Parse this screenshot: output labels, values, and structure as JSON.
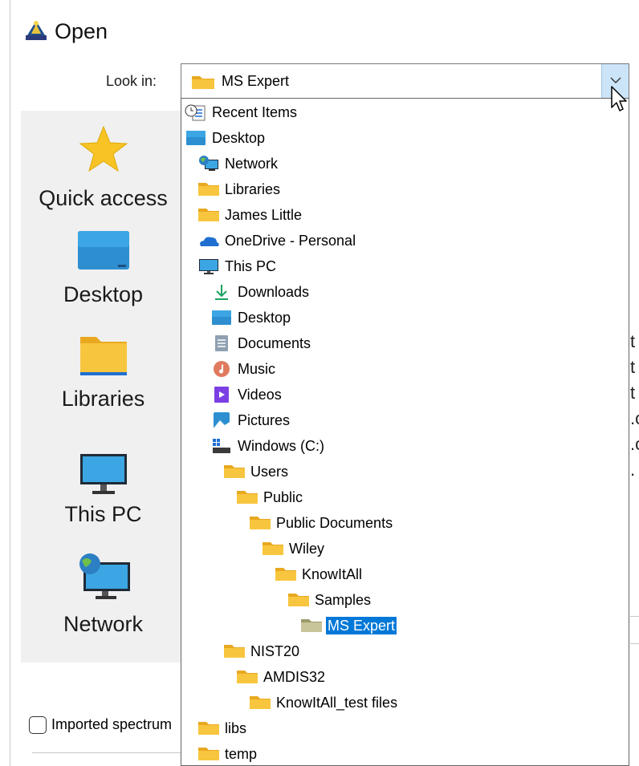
{
  "window": {
    "title": "Open"
  },
  "look_in": {
    "label": "Look in:",
    "value": "MS Expert"
  },
  "places": [
    {
      "label": "Quick access",
      "icon": "star-icon"
    },
    {
      "label": "Desktop",
      "icon": "desktop-icon"
    },
    {
      "label": "Libraries",
      "icon": "folder-icon"
    },
    {
      "label": "This PC",
      "icon": "monitor-icon"
    },
    {
      "label": "Network",
      "icon": "network-icon"
    }
  ],
  "dropdown": {
    "items": [
      {
        "label": "Recent Items",
        "icon": "recent-items-icon",
        "level": 0
      },
      {
        "label": "Desktop",
        "icon": "desktop-icon",
        "level": 0
      },
      {
        "label": "Network",
        "icon": "network-icon",
        "level": 1
      },
      {
        "label": "Libraries",
        "icon": "folder-icon",
        "level": 1
      },
      {
        "label": "James Little",
        "icon": "folder-icon",
        "level": 1
      },
      {
        "label": "OneDrive - Personal",
        "icon": "onedrive-icon",
        "level": 1
      },
      {
        "label": "This PC",
        "icon": "monitor-icon",
        "level": 1
      },
      {
        "label": "Downloads",
        "icon": "downloads-icon",
        "level": 2
      },
      {
        "label": "Desktop",
        "icon": "desktop-icon",
        "level": 2
      },
      {
        "label": "Documents",
        "icon": "documents-icon",
        "level": 2
      },
      {
        "label": "Music",
        "icon": "music-icon",
        "level": 2
      },
      {
        "label": "Videos",
        "icon": "videos-icon",
        "level": 2
      },
      {
        "label": "Pictures",
        "icon": "pictures-icon",
        "level": 2
      },
      {
        "label": "Windows (C:)",
        "icon": "drive-icon",
        "level": 2
      },
      {
        "label": "Users",
        "icon": "folder-icon",
        "level": 3
      },
      {
        "label": "Public",
        "icon": "folder-icon",
        "level": 4
      },
      {
        "label": "Public Documents",
        "icon": "folder-icon",
        "level": 5
      },
      {
        "label": "Wiley",
        "icon": "folder-icon",
        "level": 6
      },
      {
        "label": "KnowItAll",
        "icon": "folder-icon",
        "level": 7
      },
      {
        "label": "Samples",
        "icon": "folder-icon",
        "level": 8
      },
      {
        "label": "MS Expert",
        "icon": "folder-open-icon",
        "level": 9,
        "selected": true
      },
      {
        "label": "NIST20",
        "icon": "folder-icon",
        "level": 3
      },
      {
        "label": "AMDIS32",
        "icon": "folder-icon",
        "level": 4
      },
      {
        "label": "KnowItAll_test files",
        "icon": "folder-icon",
        "level": 5
      },
      {
        "label": "libs",
        "icon": "folder-icon",
        "level": 1
      },
      {
        "label": "temp",
        "icon": "folder-icon",
        "level": 1
      }
    ]
  },
  "behind_text": [
    "t",
    "t",
    "t",
    ".c",
    ".c",
    "."
  ],
  "options": {
    "imported_label": "Imported spectrum"
  },
  "colors": {
    "selection": "#0078d7",
    "folder": "#f8c63e",
    "dropdown_button": "#cce4f7"
  }
}
